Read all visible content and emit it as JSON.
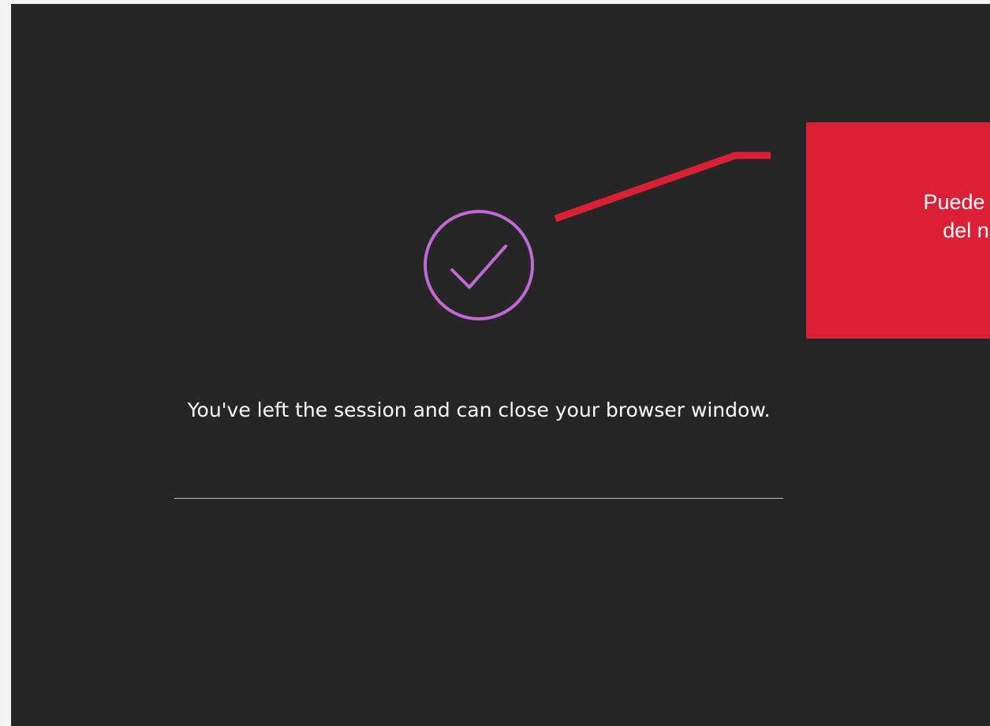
{
  "session_end": {
    "icon": "check-circle-icon",
    "message": "You've left the session and can close your browser window.",
    "accent_color": "#c06ad3",
    "background_color": "#262626"
  },
  "annotation": {
    "text": "Puede cer\ndel na",
    "box_color": "#db1f35"
  }
}
